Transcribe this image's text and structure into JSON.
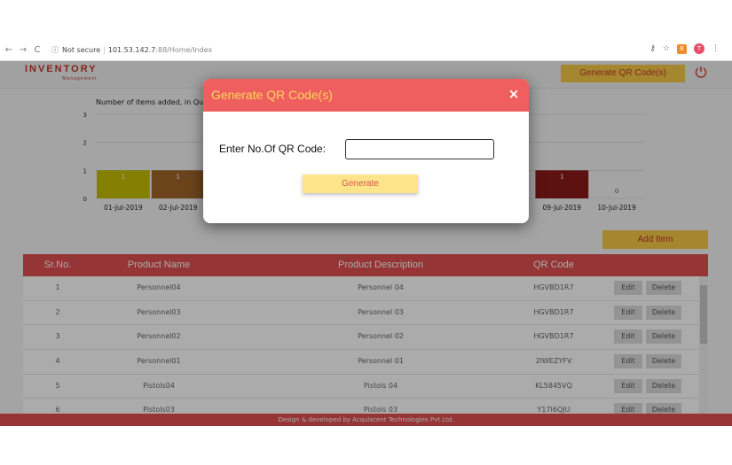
{
  "browser": {
    "security": "Not secure",
    "host": "101.53.142.7",
    "path": ":88/Home/Index",
    "ext_badge": "8",
    "avatar_initial": "T"
  },
  "header": {
    "logo_main": "INVENTORY",
    "logo_sub": "Management",
    "generate_button": "Generate QR Code(s)"
  },
  "chart_data": {
    "type": "bar",
    "title": "Number of items added, in Qu",
    "categories": [
      "01-Jul-2019",
      "02-Jul-2019",
      "",
      "",
      "",
      "",
      "",
      "",
      "09-Jul-2019",
      "10-Jul-2019"
    ],
    "values": [
      1,
      1,
      null,
      null,
      null,
      null,
      null,
      null,
      1,
      0
    ],
    "colors": [
      "#c7be00",
      "#a0662b",
      "",
      "",
      "",
      "",
      "",
      "",
      "#8b1a1a",
      "#999999"
    ],
    "ylim": [
      0,
      3
    ],
    "yticks": [
      0,
      1,
      2,
      3
    ],
    "grid": true
  },
  "add_item_button": "Add Item",
  "table": {
    "columns": [
      "Sr.No.",
      "Product Name",
      "Product Description",
      "QR Code"
    ],
    "edit_label": "Edit",
    "delete_label": "Delete",
    "rows": [
      {
        "sr": "1",
        "name": "Personnel04",
        "desc": "Personnel 04",
        "qr": "HGVBD1R7"
      },
      {
        "sr": "2",
        "name": "Personnel03",
        "desc": "Personnel 03",
        "qr": "HGVBD1R7"
      },
      {
        "sr": "3",
        "name": "Personnel02",
        "desc": "Personnel 02",
        "qr": "HGVBD1R7"
      },
      {
        "sr": "4",
        "name": "Personnel01",
        "desc": "Personnel 01",
        "qr": "2IWEZYFV"
      },
      {
        "sr": "5",
        "name": "Pistols04",
        "desc": "Pistols 04",
        "qr": "KL5845VQ"
      },
      {
        "sr": "6",
        "name": "Pistols03",
        "desc": "Pistols 03",
        "qr": "Y17I6QJU"
      }
    ]
  },
  "footer": "Design & developed by Acquiscent Technologies Pvt.Ltd.",
  "modal": {
    "title": "Generate QR Code(s)",
    "close": "×",
    "label": "Enter No.Of QR Code:",
    "input_value": "",
    "generate_button": "Generate"
  }
}
